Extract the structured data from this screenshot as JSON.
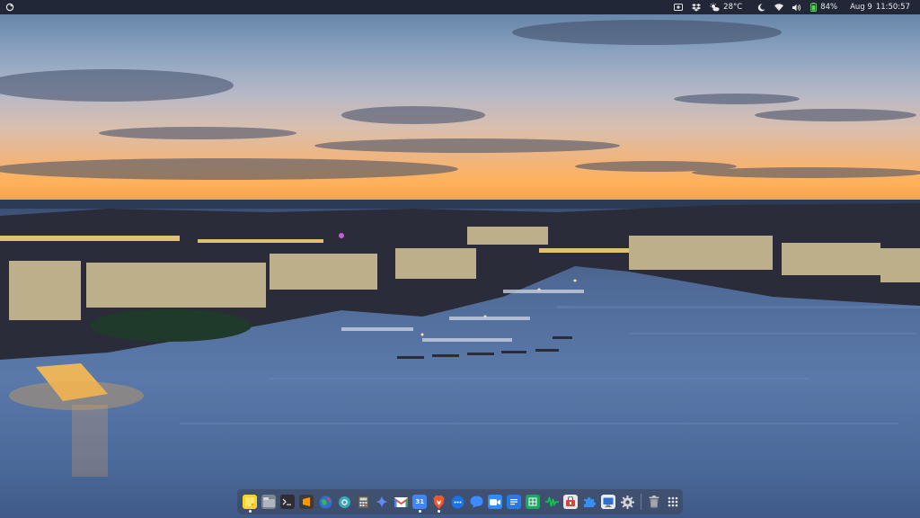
{
  "topbar": {
    "activities_icon": "gnome-activities-icon",
    "tray": {
      "screenshot_icon": "screenshot-icon",
      "dropbox_icon": "dropbox-icon",
      "weather_icon": "sun-cloud-icon",
      "temperature": "28°C",
      "night_light_icon": "moon-icon",
      "wifi_icon": "wifi-icon",
      "volume_icon": "speaker-icon",
      "battery_icon": "battery-icon",
      "battery_percent": "84%",
      "date": "Aug 9",
      "time": "11:50:57"
    }
  },
  "dock": {
    "items": [
      {
        "name": "sticky-notes",
        "icon": "sticky-note-icon",
        "running": true
      },
      {
        "name": "files",
        "icon": "files-icon",
        "running": false
      },
      {
        "name": "terminal",
        "icon": "terminal-icon",
        "running": false
      },
      {
        "name": "sublime-text",
        "icon": "sublime-icon",
        "running": false
      },
      {
        "name": "browser",
        "icon": "globe-icon",
        "running": false
      },
      {
        "name": "help",
        "icon": "lifebuoy-icon",
        "running": false
      },
      {
        "name": "calculator",
        "icon": "calculator-icon",
        "running": false
      },
      {
        "name": "gemini",
        "icon": "sparkle-icon",
        "running": false
      },
      {
        "name": "gmail",
        "icon": "gmail-icon",
        "running": false
      },
      {
        "name": "calendar",
        "icon": "calendar-icon",
        "label": "31",
        "running": true
      },
      {
        "name": "brave",
        "icon": "brave-icon",
        "running": true
      },
      {
        "name": "messages",
        "icon": "chat-dots-icon",
        "running": false
      },
      {
        "name": "chat",
        "icon": "chat-icon",
        "running": false
      },
      {
        "name": "meet",
        "icon": "video-icon",
        "running": false
      },
      {
        "name": "docs",
        "icon": "docs-icon",
        "running": false
      },
      {
        "name": "sheets",
        "icon": "sheets-icon",
        "running": false
      },
      {
        "name": "audio-analyzer",
        "icon": "waveform-icon",
        "running": false
      },
      {
        "name": "store",
        "icon": "store-icon",
        "running": false
      },
      {
        "name": "extensions",
        "icon": "puzzle-icon",
        "running": false
      },
      {
        "name": "remote-desktop",
        "icon": "monitor-icon",
        "running": false
      },
      {
        "name": "settings",
        "icon": "gear-icon",
        "running": false
      }
    ],
    "trash_icon": "trash-icon",
    "app_grid_icon": "app-grid-icon"
  },
  "colors": {
    "topbar_bg": "#1c202d",
    "sky_top": "#5a7ba0",
    "horizon": "#ffb25a",
    "sea": "#4f6a96"
  }
}
